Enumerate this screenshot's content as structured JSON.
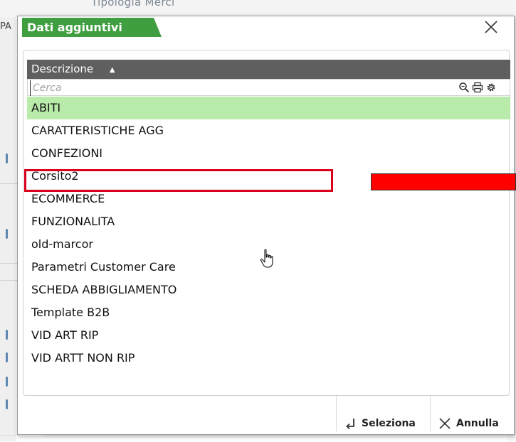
{
  "background": {
    "top_text": "Tipologia   Merci",
    "left_fragment": "PA"
  },
  "dialog": {
    "title": "Dati aggiuntivi",
    "close_icon": "close-icon"
  },
  "grid": {
    "column_header": "Descrizione",
    "sort_icon": "sort-ascending-icon",
    "search_placeholder": "Cerca",
    "search_value": "",
    "toolbar_icons": [
      "search-zoom-icon",
      "print-icon",
      "settings-gear-icon"
    ],
    "selected_index": 0,
    "rows": [
      "ABITI",
      "CARATTERISTICHE AGG",
      "CONFEZIONI",
      "Corsito2",
      "ECOMMERCE",
      "FUNZIONALITA",
      "old-marcor",
      "Parametri Customer Care",
      "SCHEDA ABBIGLIAMENTO",
      "Template B2B",
      "VID ART RIP",
      "VID ARTT NON RIP"
    ]
  },
  "buttons": {
    "select_label": "Seleziona",
    "cancel_label": "Annulla"
  },
  "colors": {
    "title_green": "#3f9e3f",
    "header_gray": "#5f5f5f",
    "selected_row": "#b9ebaa",
    "highlight_red": "#d8001c",
    "annotation_red": "#ff0000"
  }
}
